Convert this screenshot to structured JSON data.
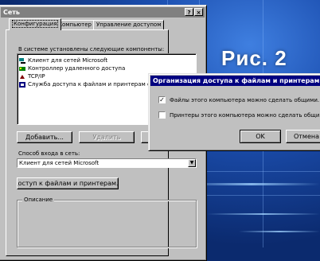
{
  "figure_label": "Рис. 2",
  "network_dialog": {
    "title": "Сеть",
    "title_buttons": [
      "?",
      "×"
    ],
    "tabs": [
      {
        "label": "Конфигурация",
        "selected": true
      },
      {
        "label": "Компьютер",
        "selected": false
      },
      {
        "label": "Управление доступом",
        "selected": false
      }
    ],
    "components_label": "В системе установлены следующие компоненты:",
    "components": [
      {
        "label": "Клиент для сетей Microsoft",
        "icon": "network-client-icon"
      },
      {
        "label": "Контроллер удаленного доступа",
        "icon": "network-adapter-icon"
      },
      {
        "label": "TCP/IP",
        "icon": "protocol-icon"
      },
      {
        "label": "Служба доступа к файлам и принтерам с",
        "icon": "service-icon"
      }
    ],
    "add_button": "Добавить...",
    "remove_button": "Удалить",
    "logon_label": "Способ входа в сеть:",
    "logon_value": "Клиент для сетей Microsoft",
    "file_print_button": "Доступ к файлам и принтерам...",
    "description_label": "Описание"
  },
  "sharing_dialog": {
    "title": "Организация доступа к файлам и принтерам",
    "options": [
      {
        "label": "Файлы этого компьютера можно сделать общими.",
        "checked": true
      },
      {
        "label": "Принтеры этого компьютера можно сделать общими.",
        "checked": false
      }
    ],
    "ok_button": "OK",
    "cancel_button": "Отмена"
  }
}
